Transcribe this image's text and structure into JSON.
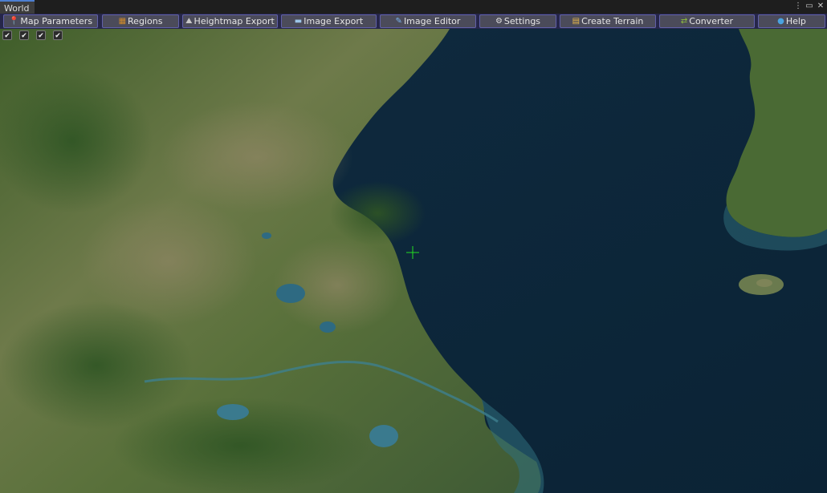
{
  "window": {
    "title": "World"
  },
  "toolbar": {
    "buttons": [
      {
        "label": "Map Parameters",
        "icon": "map-pin-icon",
        "color": "#4aa3e0"
      },
      {
        "label": "Regions",
        "icon": "grid-icon",
        "color": "#d08a2a"
      },
      {
        "label": "Heightmap Export",
        "icon": "mountain-icon",
        "color": "#c8c8c8"
      },
      {
        "label": "Image Export",
        "icon": "image-icon",
        "color": "#9cc6e8"
      },
      {
        "label": "Image Editor",
        "icon": "pen-icon",
        "color": "#7bb6f0"
      },
      {
        "label": "Settings",
        "icon": "gear-icon",
        "color": "#e0e0e0"
      },
      {
        "label": "Create Terrain",
        "icon": "terrain-icon",
        "color": "#e8b84a"
      },
      {
        "label": "Converter",
        "icon": "converter-icon",
        "color": "#8fbf3c"
      },
      {
        "label": "Help",
        "icon": "help-icon",
        "color": "#4aa3e0"
      }
    ]
  },
  "checkboxes": [
    {
      "checked": true
    },
    {
      "checked": true
    },
    {
      "checked": true
    },
    {
      "checked": true
    }
  ],
  "map": {
    "sea_color": "#0e2a3e",
    "land_color": "#4f6a34",
    "crosshair_color": "#22dd22"
  }
}
